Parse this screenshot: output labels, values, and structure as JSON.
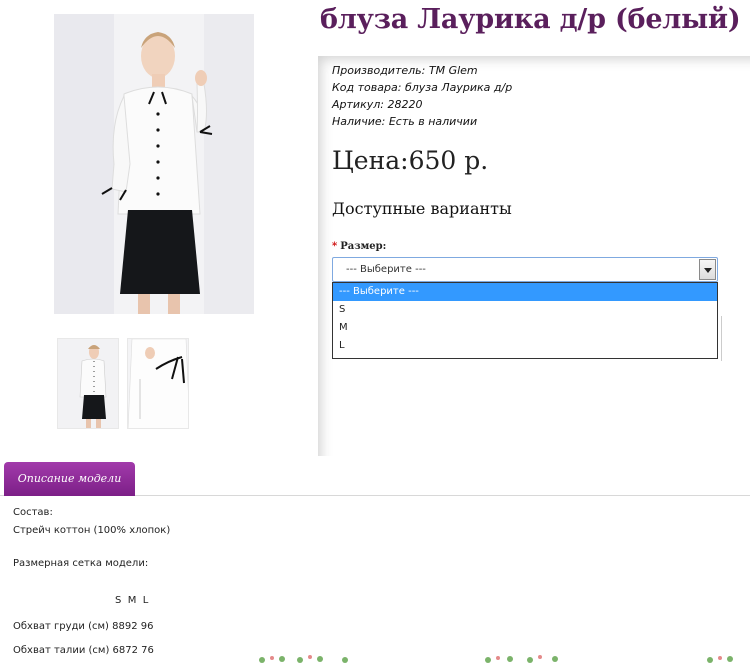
{
  "product": {
    "title": "блуза Лаурика д/р (белый)",
    "manufacturer_label": "Производитель:",
    "manufacturer_value": "TM Glem",
    "code_label": "Код товара:",
    "code_value": "блуза Лаурика д/р",
    "sku_label": "Артикул:",
    "sku_value": "28220",
    "availability_label": "Наличие:",
    "availability_value": "Есть в наличии",
    "price": "Цена:650 р."
  },
  "options": {
    "heading": "Доступные варианты",
    "size_label": "Размер:",
    "required_mark": "*",
    "select_value": "--- Выберите ---",
    "dropdown_items": [
      "--- Выберите ---",
      "S",
      "M",
      "L"
    ]
  },
  "tab": {
    "label": "Описание модели"
  },
  "description": {
    "composition_label": "Состав:",
    "composition_value": "Стрейч коттон (100% хлопок)",
    "size_grid_label": "Размерная сетка модели:",
    "size_header": "S  M  L",
    "chest": "Обхват груди (см) 8892 96",
    "waist": "Обхват талии (см) 6872 76"
  },
  "colors": {
    "title": "#5a1f5c",
    "tab": "#8e2a98",
    "dropdown_highlight": "#3399ff"
  }
}
